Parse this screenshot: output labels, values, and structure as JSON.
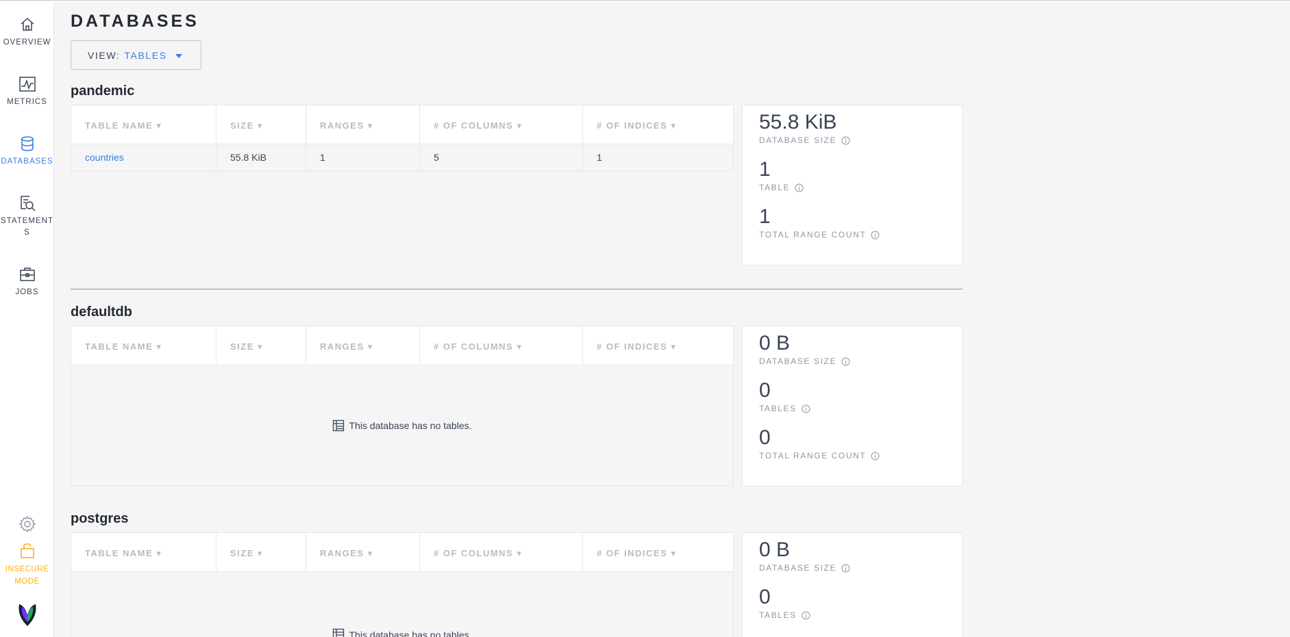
{
  "sidebar": {
    "items": [
      {
        "name": "overview",
        "label": "OVERVIEW",
        "icon": "home-icon"
      },
      {
        "name": "metrics",
        "label": "METRICS",
        "icon": "pulse-chart-icon"
      },
      {
        "name": "databases",
        "label": "DATABASES",
        "icon": "database-icon"
      },
      {
        "name": "statements",
        "label": "STATEMENTS",
        "icon": "statements-search-icon"
      },
      {
        "name": "jobs",
        "label": "JOBS",
        "icon": "briefcase-icon"
      }
    ],
    "settings_icon": "gear-icon",
    "insecure_label": "INSECURE MODE",
    "logo_icon": "cockroach-logo-icon"
  },
  "page": {
    "title": "DATABASES",
    "view_label": "VIEW:",
    "view_value": "TABLES"
  },
  "columns": [
    "TABLE NAME ▾",
    "SIZE ▾",
    "RANGES ▾",
    "# OF COLUMNS ▾",
    "# OF INDICES ▾"
  ],
  "databases": [
    {
      "name": "pandemic",
      "rows": [
        {
          "table": "countries",
          "size": "55.8 KiB",
          "ranges": "1",
          "columns": "5",
          "indices": "1"
        }
      ],
      "size": "55.8 KiB",
      "size_label": "DATABASE SIZE",
      "tables": "1",
      "tables_label": "TABLE",
      "ranges": "1",
      "ranges_label": "TOTAL RANGE COUNT"
    },
    {
      "name": "defaultdb",
      "empty_text": "This database has no tables.",
      "size": "0 B",
      "size_label": "DATABASE SIZE",
      "tables": "0",
      "tables_label": "TABLES",
      "ranges": "0",
      "ranges_label": "TOTAL RANGE COUNT"
    },
    {
      "name": "postgres",
      "empty_text": "This database has no tables.",
      "size": "0 B",
      "size_label": "DATABASE SIZE",
      "tables": "0",
      "tables_label": "TABLES"
    }
  ],
  "colors": {
    "accent": "#3a7de1",
    "warning": "#ffb11d",
    "text": "#394455",
    "muted": "#b6bbc4"
  }
}
